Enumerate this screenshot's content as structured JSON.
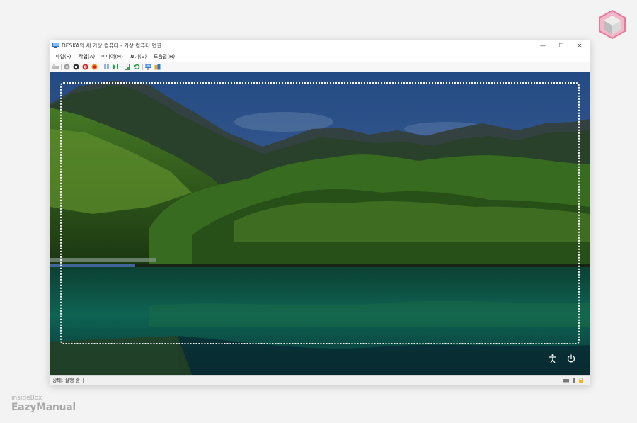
{
  "window": {
    "title": "DESKA의 새 가상 컴퓨터 - 가상 컴퓨터 연결",
    "controls": {
      "minimize": "—",
      "maximize": "☐",
      "close": "✕"
    }
  },
  "menu": [
    {
      "label": "파일(F)"
    },
    {
      "label": "작업(A)"
    },
    {
      "label": "미디어(M)"
    },
    {
      "label": "보기(V)"
    },
    {
      "label": "도움말(H)"
    }
  ],
  "toolbar": {
    "icons": [
      "ctrl-alt-del-icon",
      "start-icon",
      "turn-off-icon",
      "shut-down-icon",
      "save-icon",
      "pause-icon",
      "reset-icon",
      "checkpoint-icon",
      "revert-icon",
      "enhanced-session-icon",
      "share-icon"
    ]
  },
  "lockscreen": {
    "icons": [
      "ease-of-access-icon",
      "power-icon"
    ]
  },
  "status": {
    "text": "상태: 실행 중",
    "icons": [
      "keyboard-icon",
      "mouse-icon",
      "lock-icon"
    ]
  },
  "watermark": {
    "line1": "insideBox",
    "line2": "EazyManual"
  },
  "colors": {
    "accent": "#1e6fc9",
    "sky": "#3c6eb4",
    "lake": "#0f5b4a"
  }
}
